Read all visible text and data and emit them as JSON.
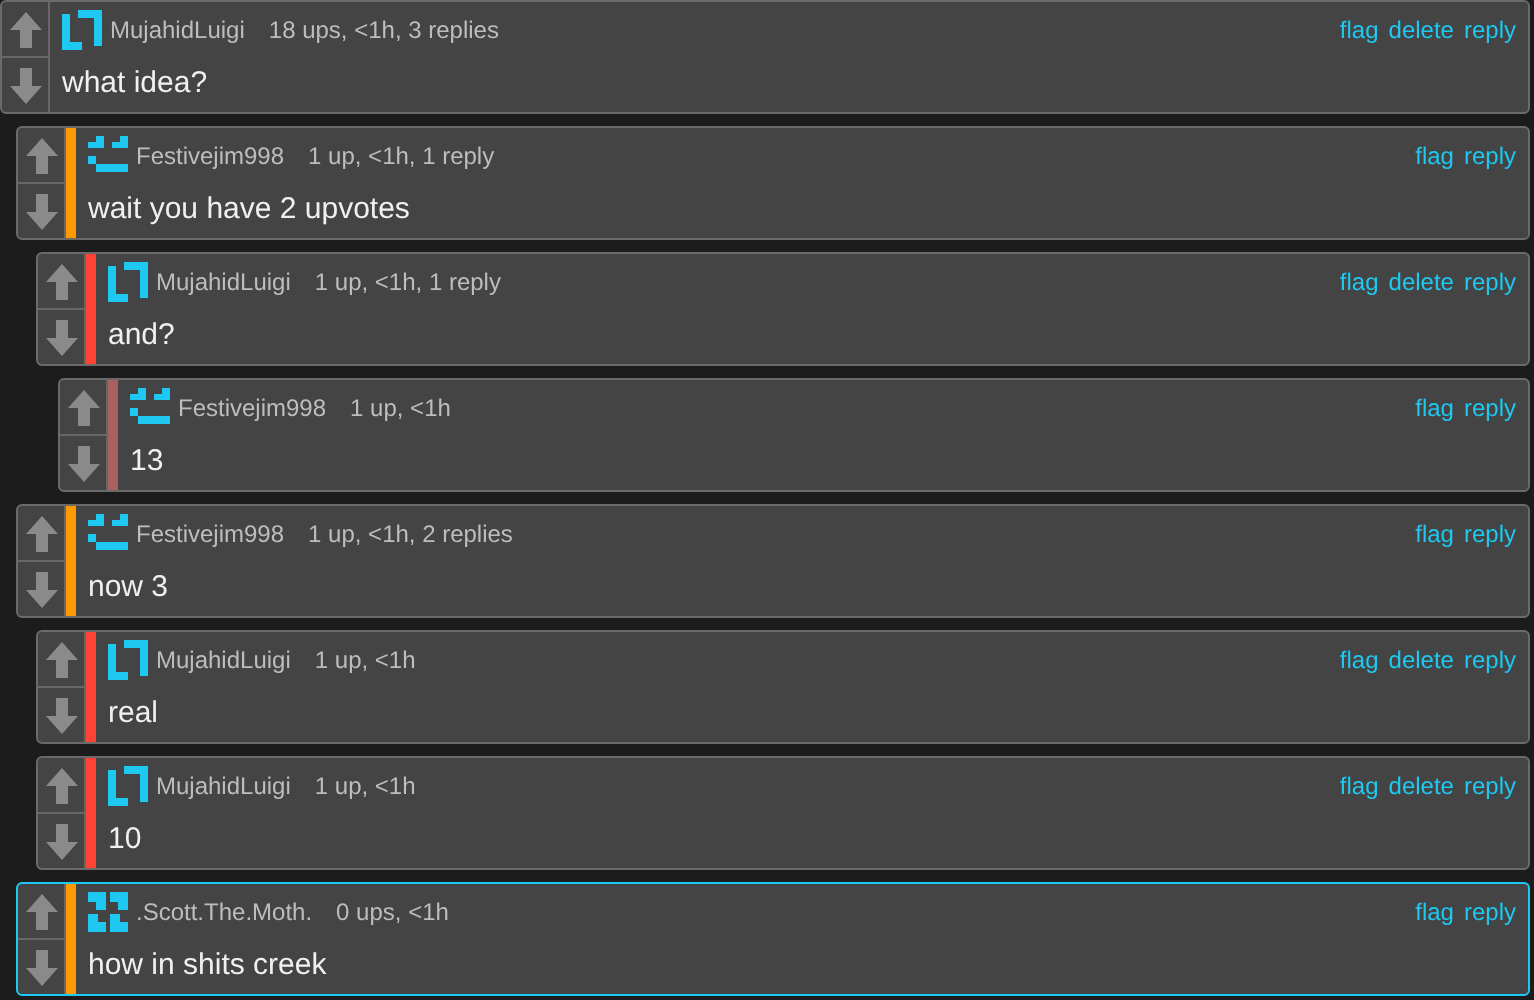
{
  "comments": [
    {
      "username": "MujahidLuigi",
      "kind": "bracket",
      "meta": "18 ups, <1h, 3 replies",
      "text": "what idea?",
      "actions": [
        "flag",
        "delete",
        "reply"
      ],
      "highlighted": false,
      "children": [
        {
          "username": "Festivejim998",
          "kind": "smile",
          "color": "#ff9900",
          "meta": "1 up, <1h, 1 reply",
          "text": "wait you have 2 upvotes",
          "actions": [
            "flag",
            "reply"
          ],
          "highlighted": false,
          "children": [
            {
              "username": "MujahidLuigi",
              "kind": "bracket",
              "color": "#ff4433",
              "meta": "1 up, <1h, 1 reply",
              "text": "and?",
              "actions": [
                "flag",
                "delete",
                "reply"
              ],
              "highlighted": false,
              "children": [
                {
                  "username": "Festivejim998",
                  "kind": "smile",
                  "color": "#a86060",
                  "meta": "1 up, <1h",
                  "text": "13",
                  "actions": [
                    "flag",
                    "reply"
                  ],
                  "highlighted": false
                }
              ]
            }
          ]
        },
        {
          "username": "Festivejim998",
          "kind": "smile",
          "color": "#ff9900",
          "meta": "1 up, <1h, 2 replies",
          "text": "now 3",
          "actions": [
            "flag",
            "reply"
          ],
          "highlighted": false,
          "children": [
            {
              "username": "MujahidLuigi",
              "kind": "bracket",
              "color": "#ff4433",
              "meta": "1 up, <1h",
              "text": "real",
              "actions": [
                "flag",
                "delete",
                "reply"
              ],
              "highlighted": false
            },
            {
              "username": "MujahidLuigi",
              "kind": "bracket",
              "color": "#ff4433",
              "meta": "1 up, <1h",
              "text": "10",
              "actions": [
                "flag",
                "delete",
                "reply"
              ],
              "highlighted": false
            }
          ]
        },
        {
          "username": ".Scott.The.Moth.",
          "kind": "blocks",
          "color": "#ff9900",
          "meta": "0 ups, <1h",
          "text": "how in shits creek",
          "actions": [
            "flag",
            "reply"
          ],
          "highlighted": true
        }
      ]
    }
  ]
}
